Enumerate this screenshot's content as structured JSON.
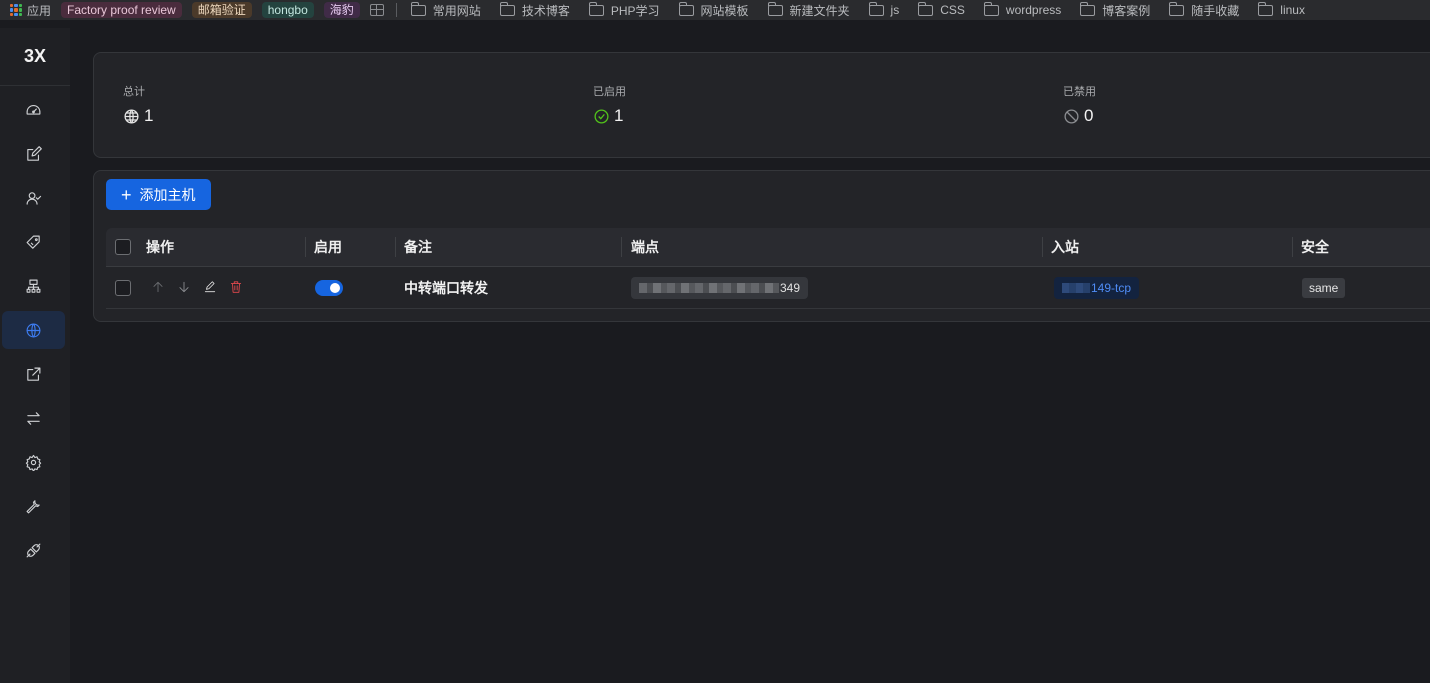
{
  "bookmarks": {
    "apps_label": "应用",
    "tags": [
      "Factory proof review",
      "邮箱验证",
      "hongbo",
      "海豹"
    ],
    "folders": [
      "常用网站",
      "技术博客",
      "PHP学习",
      "网站模板",
      "新建文件夹",
      "js",
      "CSS",
      "wordpress",
      "博客案例",
      "随手收藏",
      "linux"
    ]
  },
  "sidebar": {
    "logo": "3X",
    "items": [
      {
        "icon": "dashboard-icon"
      },
      {
        "icon": "edit-square-icon"
      },
      {
        "icon": "users-icon"
      },
      {
        "icon": "tag-icon"
      },
      {
        "icon": "cluster-icon"
      },
      {
        "icon": "globe-icon",
        "active": true
      },
      {
        "icon": "external-link-icon"
      },
      {
        "icon": "swap-icon"
      },
      {
        "icon": "gear-icon"
      },
      {
        "icon": "tool-icon"
      },
      {
        "icon": "api-icon"
      }
    ]
  },
  "stats": {
    "total_label": "总计",
    "total_value": "1",
    "enabled_label": "已启用",
    "enabled_value": "1",
    "disabled_label": "已禁用",
    "disabled_value": "0"
  },
  "hosts": {
    "add_button": "添加主机",
    "columns": {
      "actions": "操作",
      "enable": "启用",
      "remark": "备注",
      "endpoint": "端点",
      "inbound": "入站",
      "security": "安全"
    },
    "rows": [
      {
        "enabled": true,
        "remark": "中转端口转发",
        "endpoint_suffix": "349",
        "inbound_suffix": "149-tcp",
        "security": "same"
      }
    ]
  },
  "colors": {
    "accent": "#1665e0",
    "success": "#52c41a",
    "danger": "#e5484d",
    "background": "#1a1b1f",
    "card": "#232428"
  }
}
